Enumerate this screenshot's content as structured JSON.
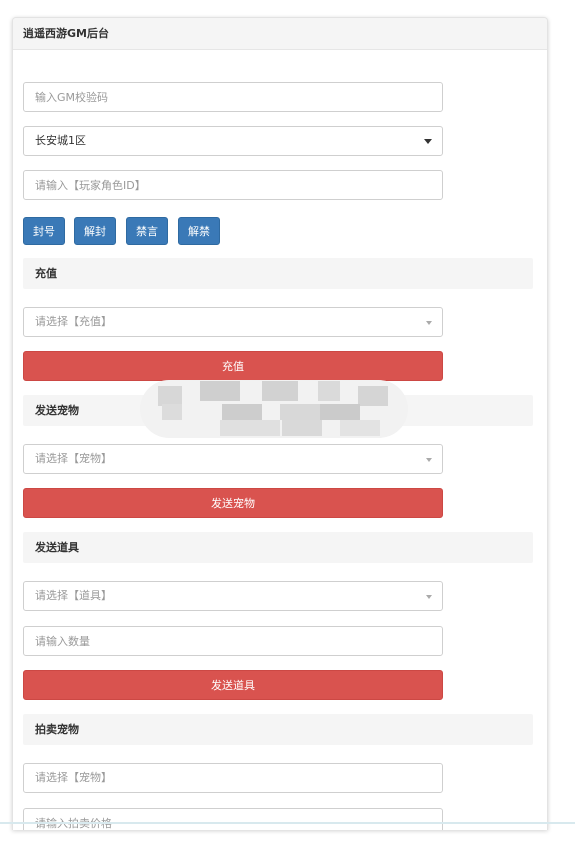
{
  "app": {
    "title": "逍遥西游GM后台"
  },
  "gm": {
    "code_placeholder": "输入GM校验码",
    "server_selected": "长安城1区",
    "player_placeholder": "请输入【玩家角色ID】",
    "buttons": [
      "封号",
      "解封",
      "禁言",
      "解禁"
    ]
  },
  "recharge": {
    "title": "充值",
    "select_placeholder": "请选择【充值】",
    "button": "充值"
  },
  "pet": {
    "title": "发送宠物",
    "select_placeholder": "请选择【宠物】",
    "button": "发送宠物"
  },
  "item": {
    "title": "发送道具",
    "select_placeholder": "请选择【道具】",
    "qty_placeholder": "请输入数量",
    "button": "发送道具"
  },
  "auction": {
    "title": "拍卖宠物",
    "select_placeholder": "请选择【宠物】",
    "price_placeholder": "请输入拍卖价格"
  },
  "colors": {
    "primary": "#3a79b7",
    "danger": "#d9534f",
    "panel_bg": "#f5f5f5"
  }
}
